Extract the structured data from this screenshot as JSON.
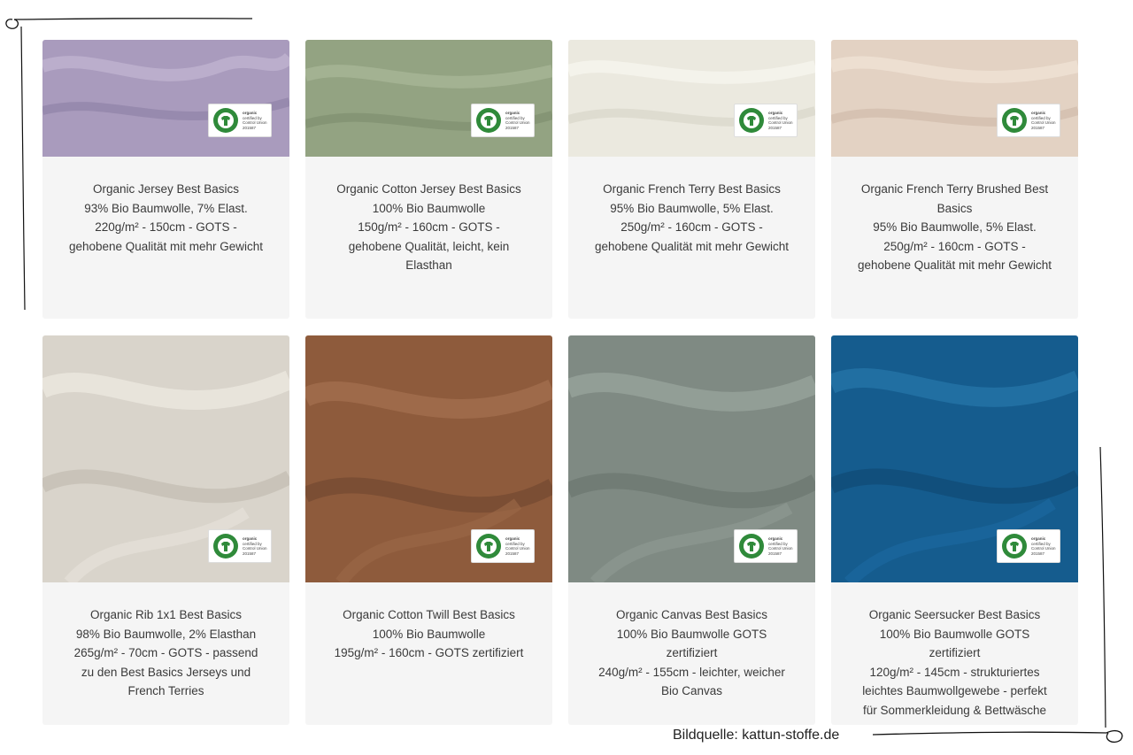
{
  "products": [
    {
      "name": "Organic Jersey Best Basics",
      "composition": "93% Bio Baumwolle, 7% Elast.",
      "details": "220g/m² - 150cm - GOTS - gehobene Qualität mit mehr Gewicht",
      "fabric_color": "#a99bbd"
    },
    {
      "name": "Organic Cotton Jersey Best Basics",
      "composition": "100% Bio Baumwolle",
      "details": "150g/m² - 160cm - GOTS - gehobene Qualität, leicht, kein Elasthan",
      "fabric_color": "#93a382"
    },
    {
      "name": "Organic French Terry Best Basics",
      "composition": "95% Bio Baumwolle, 5% Elast.",
      "details": "250g/m² - 160cm - GOTS - gehobene Qualität mit mehr Gewicht",
      "fabric_color": "#ebe9df"
    },
    {
      "name": "Organic French Terry Brushed Best Basics",
      "composition": "95% Bio Baumwolle, 5% Elast.",
      "details": "250g/m² - 160cm - GOTS - gehobene Qualität mit mehr Gewicht",
      "fabric_color": "#e3d2c3"
    },
    {
      "name": "Organic Rib 1x1 Best Basics",
      "composition": "98% Bio Baumwolle, 2% Elasthan",
      "details": "265g/m² - 70cm - GOTS - passend zu den Best Basics Jerseys und French Terries",
      "fabric_color": "#d9d4cb"
    },
    {
      "name": "Organic Cotton Twill Best Basics",
      "composition": "100% Bio Baumwolle",
      "details": "195g/m² - 160cm - GOTS zertifiziert",
      "fabric_color": "#8e5b3c"
    },
    {
      "name": "Organic Canvas Best Basics",
      "composition": "100% Bio Baumwolle GOTS zertifiziert",
      "details": "240g/m² - 155cm - leichter, weicher Bio Canvas",
      "fabric_color": "#7f8a83"
    },
    {
      "name": "Organic Seersucker Best Basics",
      "composition": "100% Bio Baumwolle GOTS zertifiziert",
      "details": "120g/m² - 145cm - strukturiertes leichtes Baumwollgewebe - perfekt für Sommerkleidung & Bettwäsche",
      "fabric_color": "#155c8e"
    }
  ],
  "badge": {
    "line1": "organic",
    "line2": "certified by",
    "line3": "Control Union",
    "line4": "201587"
  },
  "caption": "Bildquelle: kattun-stoffe.de"
}
